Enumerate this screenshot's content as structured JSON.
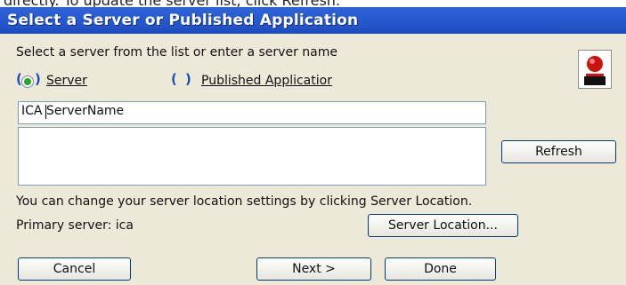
{
  "behind_text": "directly. To update the server list, click Refresh.",
  "window": {
    "title": "Select a Server or Published Application"
  },
  "instruction": "Select a server from the list or enter a server name",
  "radio_server": {
    "label": "Server",
    "selected": true
  },
  "radio_published": {
    "label": "Published Applicatior",
    "selected": false
  },
  "server_input": {
    "value": "ICA ServerName"
  },
  "refresh_button": {
    "label": "Refresh"
  },
  "location_note": "You can change your server location settings by clicking Server Location.",
  "primary_server": "Primary server: ica",
  "server_location_button": {
    "label": "Server Location..."
  },
  "cancel_button": {
    "label": "Cancel"
  },
  "next_button": {
    "label": "Next >"
  },
  "done_button": {
    "label": "Done"
  },
  "colors": {
    "titlebar": "#2658cd",
    "dialog_bg": "#ece9d8",
    "radio_selected": "#29a329"
  }
}
